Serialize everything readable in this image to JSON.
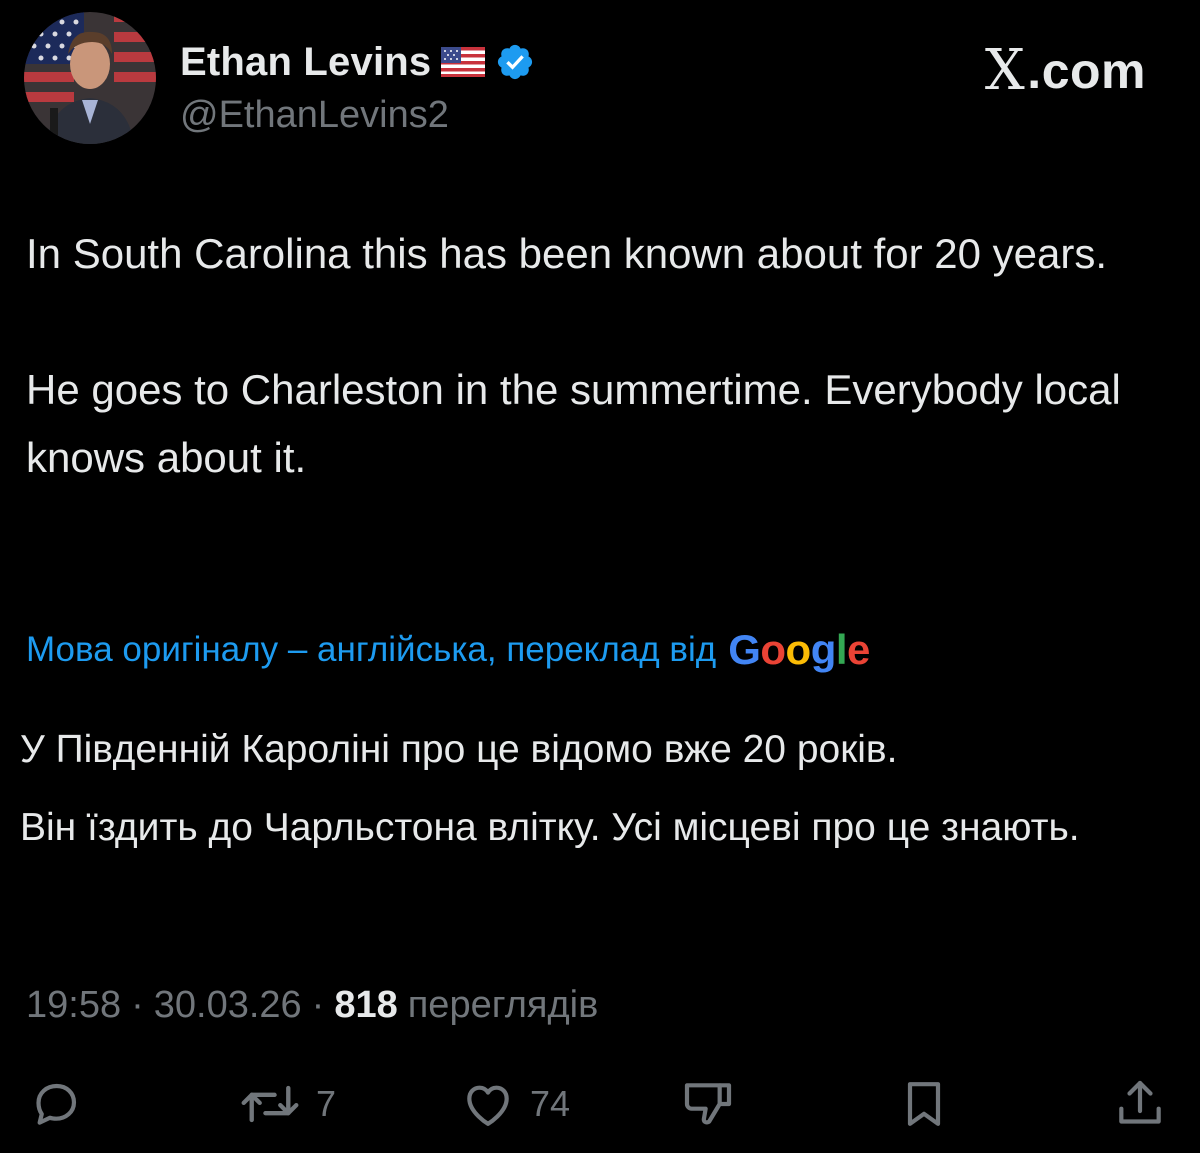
{
  "author": {
    "display_name": "Ethan Levins",
    "handle": "@EthanLevins2",
    "flag_icon": "us-flag-icon",
    "verified_icon": "verified-badge-icon"
  },
  "site_label": "com",
  "site_mark": "X",
  "tweet": {
    "paragraphs": [
      "In South Carolina this has been known about for 20 years.",
      "He goes to Charleston in the summertime. Everybody local knows about it."
    ]
  },
  "translation": {
    "notice": "Мова оригіналу – англійська, переклад від",
    "provider_letters": [
      "G",
      "o",
      "o",
      "g",
      "l",
      "e"
    ],
    "paragraphs": [
      "У Південній Кароліні про це відомо вже 20 років.",
      "Він їздить до Чарльстона влітку. Усі місцеві про це знають."
    ]
  },
  "meta": {
    "time": "19:58",
    "date": "30.03.26",
    "separator": "·",
    "views_count": "818",
    "views_label": "переглядів"
  },
  "actions": {
    "reply": {
      "icon": "reply-icon",
      "count": ""
    },
    "repost": {
      "icon": "repost-icon",
      "count": "7"
    },
    "like": {
      "icon": "heart-icon",
      "count": "74"
    },
    "dislike": {
      "icon": "thumbs-down-icon",
      "count": ""
    },
    "bookmark": {
      "icon": "bookmark-icon",
      "count": ""
    },
    "share": {
      "icon": "share-icon",
      "count": ""
    }
  },
  "colors": {
    "background": "#000000",
    "text": "#e7e9ea",
    "secondary": "#71767b",
    "link": "#1d9bf0",
    "verified": "#1d9bf0"
  }
}
